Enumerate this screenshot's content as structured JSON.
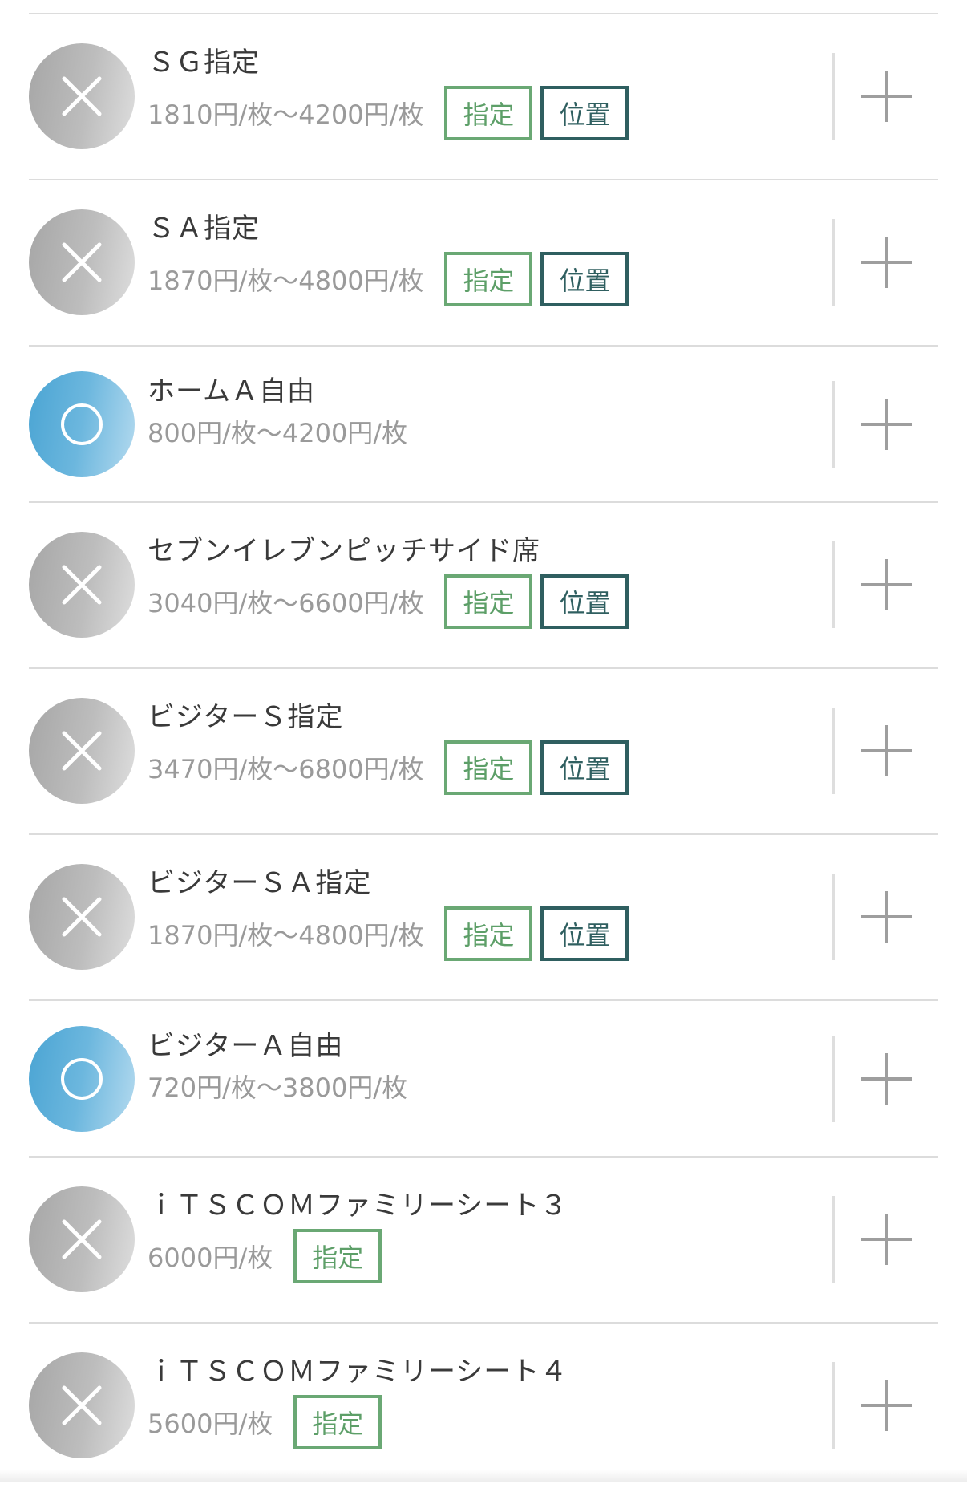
{
  "tag_labels": {
    "shitei": "指定",
    "ichi": "位置"
  },
  "seats": [
    {
      "name": "ＳＧ指定",
      "price": "1810円/枚〜4200円/枚",
      "status": "sold",
      "tags": [
        "shitei",
        "ichi"
      ]
    },
    {
      "name": "ＳＡ指定",
      "price": "1870円/枚〜4800円/枚",
      "status": "sold",
      "tags": [
        "shitei",
        "ichi"
      ]
    },
    {
      "name": "ホームＡ自由",
      "price": "800円/枚〜4200円/枚",
      "status": "available",
      "tags": []
    },
    {
      "name": "セブンイレブンピッチサイド席",
      "price": "3040円/枚〜6600円/枚",
      "status": "sold",
      "tags": [
        "shitei",
        "ichi"
      ]
    },
    {
      "name": "ビジターＳ指定",
      "price": "3470円/枚〜6800円/枚",
      "status": "sold",
      "tags": [
        "shitei",
        "ichi"
      ]
    },
    {
      "name": "ビジターＳＡ指定",
      "price": "1870円/枚〜4800円/枚",
      "status": "sold",
      "tags": [
        "shitei",
        "ichi"
      ]
    },
    {
      "name": "ビジターＡ自由",
      "price": "720円/枚〜3800円/枚",
      "status": "available",
      "tags": []
    },
    {
      "name": "ｉＴＳＣＯＭファミリーシート３",
      "price": "6000円/枚",
      "status": "sold",
      "tags": [
        "shitei"
      ]
    },
    {
      "name": "ｉＴＳＣＯＭファミリーシート４",
      "price": "5600円/枚",
      "status": "sold",
      "tags": [
        "shitei"
      ]
    }
  ],
  "icons": {
    "sold": "cross-icon",
    "available": "circle-icon",
    "add": "plus-icon"
  },
  "colors": {
    "sold_gray": "#a6a6a6",
    "available_blue": "#4aa4d3",
    "shitei_green": "#6aa874",
    "ichi_teal": "#2f5f60",
    "price_gray": "#9a9a9a"
  }
}
